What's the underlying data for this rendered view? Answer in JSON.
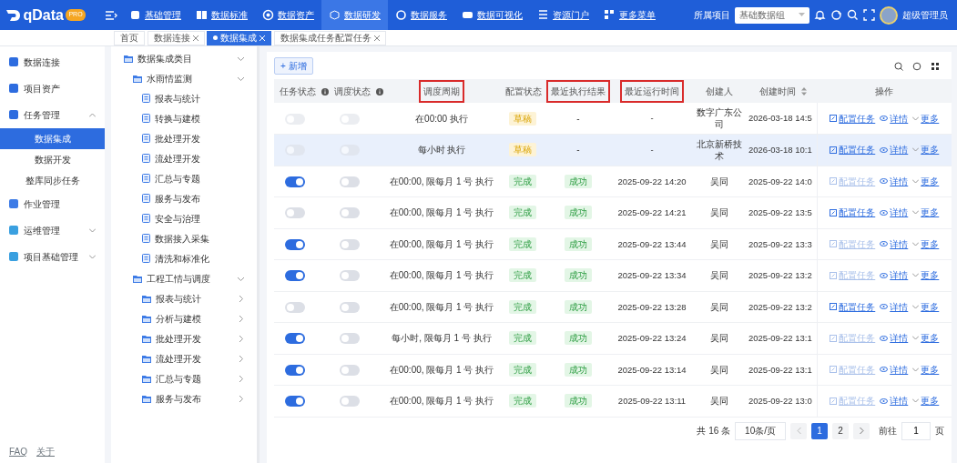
{
  "brand": {
    "name": "qData",
    "badge": "PRO"
  },
  "top_menu": [
    {
      "label": "基础管理",
      "selected": false
    },
    {
      "label": "数据标准",
      "selected": false
    },
    {
      "label": "数据资产",
      "selected": false
    },
    {
      "label": "数据研发",
      "selected": true
    },
    {
      "label": "数据服务",
      "selected": false
    },
    {
      "label": "数据可视化",
      "selected": false
    },
    {
      "label": "资源门户",
      "selected": false
    },
    {
      "label": "更多菜单",
      "selected": false
    }
  ],
  "project": {
    "label": "所属项目",
    "value": "基础数据组"
  },
  "user": {
    "name": "超级管理员"
  },
  "tabs": [
    {
      "label": "首页",
      "selected": false,
      "closable": false
    },
    {
      "label": "数据连接",
      "selected": false,
      "closable": true
    },
    {
      "label": "数据集成",
      "selected": true,
      "closable": true
    },
    {
      "label": "数据集成任务配置任务",
      "selected": false,
      "closable": true
    }
  ],
  "sidebar": {
    "items": [
      {
        "label": "数据连接",
        "selected": false
      },
      {
        "label": "项目资产",
        "selected": false
      },
      {
        "label": "任务管理",
        "expanded": true,
        "selected": false,
        "children": [
          {
            "label": "数据集成",
            "selected": true
          },
          {
            "label": "数据开发",
            "selected": false
          },
          {
            "label": "整库同步任务",
            "selected": false
          }
        ]
      },
      {
        "label": "作业管理",
        "selected": false
      },
      {
        "label": "运维管理",
        "expanded": false,
        "selected": false
      },
      {
        "label": "项目基础管理",
        "expanded": false,
        "selected": false
      }
    ],
    "footer": [
      "FAQ",
      "关于"
    ]
  },
  "tree": [
    {
      "label": "数据集成类目",
      "expanded": true,
      "children": [
        {
          "label": "水雨情监测",
          "expanded": true,
          "children": [
            {
              "label": "报表与统计"
            },
            {
              "label": "转换与建模"
            },
            {
              "label": "批处理开发"
            },
            {
              "label": "流处理开发"
            },
            {
              "label": "汇总与专题"
            },
            {
              "label": "服务与发布"
            },
            {
              "label": "安全与治理"
            },
            {
              "label": "数据接入采集"
            },
            {
              "label": "清洗和标准化"
            }
          ]
        },
        {
          "label": "工程工情与调度",
          "expanded": true,
          "children": [
            {
              "label": "报表与统计",
              "expanded": false
            },
            {
              "label": "分析与建模",
              "expanded": false
            },
            {
              "label": "批处理开发",
              "expanded": false
            },
            {
              "label": "流处理开发",
              "expanded": false
            },
            {
              "label": "汇总与专题",
              "expanded": false
            },
            {
              "label": "服务与发布",
              "expanded": false
            }
          ]
        }
      ]
    }
  ],
  "toolbar": {
    "add_button": "+ 新增"
  },
  "table": {
    "columns": [
      {
        "label": "任务状态",
        "info": true,
        "highlighted": false
      },
      {
        "label": "调度状态",
        "info": true,
        "highlighted": false
      },
      {
        "label": "调度周期",
        "highlighted": true
      },
      {
        "label": "配置状态",
        "highlighted": false
      },
      {
        "label": "最近执行结果",
        "highlighted": true
      },
      {
        "label": "最近运行时间",
        "highlighted": true
      },
      {
        "label": "创建人",
        "highlighted": false
      },
      {
        "label": "创建时间",
        "sortable": true,
        "highlighted": false
      },
      {
        "label": "操作",
        "highlighted": false
      }
    ],
    "rows": [
      {
        "selected": false,
        "task_on": false,
        "schedule_on": false,
        "cycle": "在00:00 执行",
        "config": {
          "text": "草稿",
          "kind": "warning"
        },
        "result": {
          "text": "-",
          "kind": "plain"
        },
        "last_run": "-",
        "creator": "数字广东公司",
        "created": "2026-03-18 14:5",
        "actions": [
          {
            "label": "配置任务",
            "disabled": false
          },
          {
            "label": "详情",
            "disabled": false
          },
          {
            "label": "更多",
            "disabled": false
          }
        ]
      },
      {
        "selected": true,
        "task_on": false,
        "schedule_on": false,
        "cycle": "每小时 执行",
        "config": {
          "text": "草稿",
          "kind": "warning"
        },
        "result": {
          "text": "-",
          "kind": "plain"
        },
        "last_run": "-",
        "creator": "北京新桥技术",
        "created": "2026-03-18 10:1",
        "actions": [
          {
            "label": "配置任务",
            "disabled": false
          },
          {
            "label": "详情",
            "disabled": false
          },
          {
            "label": "更多",
            "disabled": false
          }
        ]
      },
      {
        "selected": false,
        "task_on": true,
        "schedule_on": false,
        "cycle": "在00:00, 限每月 1 号 执行",
        "config": {
          "text": "完成",
          "kind": "success"
        },
        "result": {
          "text": "成功",
          "kind": "success"
        },
        "last_run": "2025-09-22 14:20",
        "creator": "吴同",
        "created": "2025-09-22 14:0",
        "actions": [
          {
            "label": "配置任务",
            "disabled": true
          },
          {
            "label": "详情",
            "disabled": false
          },
          {
            "label": "更多",
            "disabled": false
          }
        ]
      },
      {
        "selected": false,
        "task_on": false,
        "schedule_on": false,
        "cycle": "在00:00, 限每月 1 号 执行",
        "config": {
          "text": "完成",
          "kind": "success"
        },
        "result": {
          "text": "成功",
          "kind": "success"
        },
        "last_run": "2025-09-22 14:21",
        "creator": "吴同",
        "created": "2025-09-22 13:5",
        "actions": [
          {
            "label": "配置任务",
            "disabled": false
          },
          {
            "label": "详情",
            "disabled": false
          },
          {
            "label": "更多",
            "disabled": false
          }
        ]
      },
      {
        "selected": false,
        "task_on": true,
        "schedule_on": false,
        "cycle": "在00:00, 限每月 1 号 执行",
        "config": {
          "text": "完成",
          "kind": "success"
        },
        "result": {
          "text": "成功",
          "kind": "success"
        },
        "last_run": "2025-09-22 13:44",
        "creator": "吴同",
        "created": "2025-09-22 13:3",
        "actions": [
          {
            "label": "配置任务",
            "disabled": true
          },
          {
            "label": "详情",
            "disabled": false
          },
          {
            "label": "更多",
            "disabled": false
          }
        ]
      },
      {
        "selected": false,
        "task_on": true,
        "schedule_on": false,
        "cycle": "在00:00, 限每月 1 号 执行",
        "config": {
          "text": "完成",
          "kind": "success"
        },
        "result": {
          "text": "成功",
          "kind": "success"
        },
        "last_run": "2025-09-22 13:34",
        "creator": "吴同",
        "created": "2025-09-22 13:2",
        "actions": [
          {
            "label": "配置任务",
            "disabled": true
          },
          {
            "label": "详情",
            "disabled": false
          },
          {
            "label": "更多",
            "disabled": false
          }
        ]
      },
      {
        "selected": false,
        "task_on": false,
        "schedule_on": false,
        "cycle": "在00:00, 限每月 1 号 执行",
        "config": {
          "text": "完成",
          "kind": "success"
        },
        "result": {
          "text": "成功",
          "kind": "success"
        },
        "last_run": "2025-09-22 13:28",
        "creator": "吴同",
        "created": "2025-09-22 13:2",
        "actions": [
          {
            "label": "配置任务",
            "disabled": false
          },
          {
            "label": "详情",
            "disabled": false
          },
          {
            "label": "更多",
            "disabled": false
          }
        ]
      },
      {
        "selected": false,
        "task_on": true,
        "schedule_on": false,
        "cycle": "每小时, 限每月 1 号 执行",
        "config": {
          "text": "完成",
          "kind": "success"
        },
        "result": {
          "text": "成功",
          "kind": "success"
        },
        "last_run": "2025-09-22 13:24",
        "creator": "吴同",
        "created": "2025-09-22 13:1",
        "actions": [
          {
            "label": "配置任务",
            "disabled": true
          },
          {
            "label": "详情",
            "disabled": false
          },
          {
            "label": "更多",
            "disabled": false
          }
        ]
      },
      {
        "selected": false,
        "task_on": true,
        "schedule_on": false,
        "cycle": "在00:00, 限每月 1 号 执行",
        "config": {
          "text": "完成",
          "kind": "success"
        },
        "result": {
          "text": "成功",
          "kind": "success"
        },
        "last_run": "2025-09-22 13:14",
        "creator": "吴同",
        "created": "2025-09-22 13:1",
        "actions": [
          {
            "label": "配置任务",
            "disabled": true
          },
          {
            "label": "详情",
            "disabled": false
          },
          {
            "label": "更多",
            "disabled": false
          }
        ]
      },
      {
        "selected": false,
        "task_on": true,
        "schedule_on": false,
        "cycle": "在00:00, 限每月 1 号 执行",
        "config": {
          "text": "完成",
          "kind": "success"
        },
        "result": {
          "text": "成功",
          "kind": "success"
        },
        "last_run": "2025-09-22 13:11",
        "creator": "吴同",
        "created": "2025-09-22 13:0",
        "actions": [
          {
            "label": "配置任务",
            "disabled": true
          },
          {
            "label": "详情",
            "disabled": false
          },
          {
            "label": "更多",
            "disabled": false
          }
        ]
      }
    ]
  },
  "pagination": {
    "total": "共 16 条",
    "page_size": "10条/页",
    "pages": [
      {
        "label": "1",
        "selected": true
      },
      {
        "label": "2",
        "selected": false
      }
    ],
    "goto_label": "前往",
    "goto_value": "1",
    "page_suffix": "页"
  }
}
